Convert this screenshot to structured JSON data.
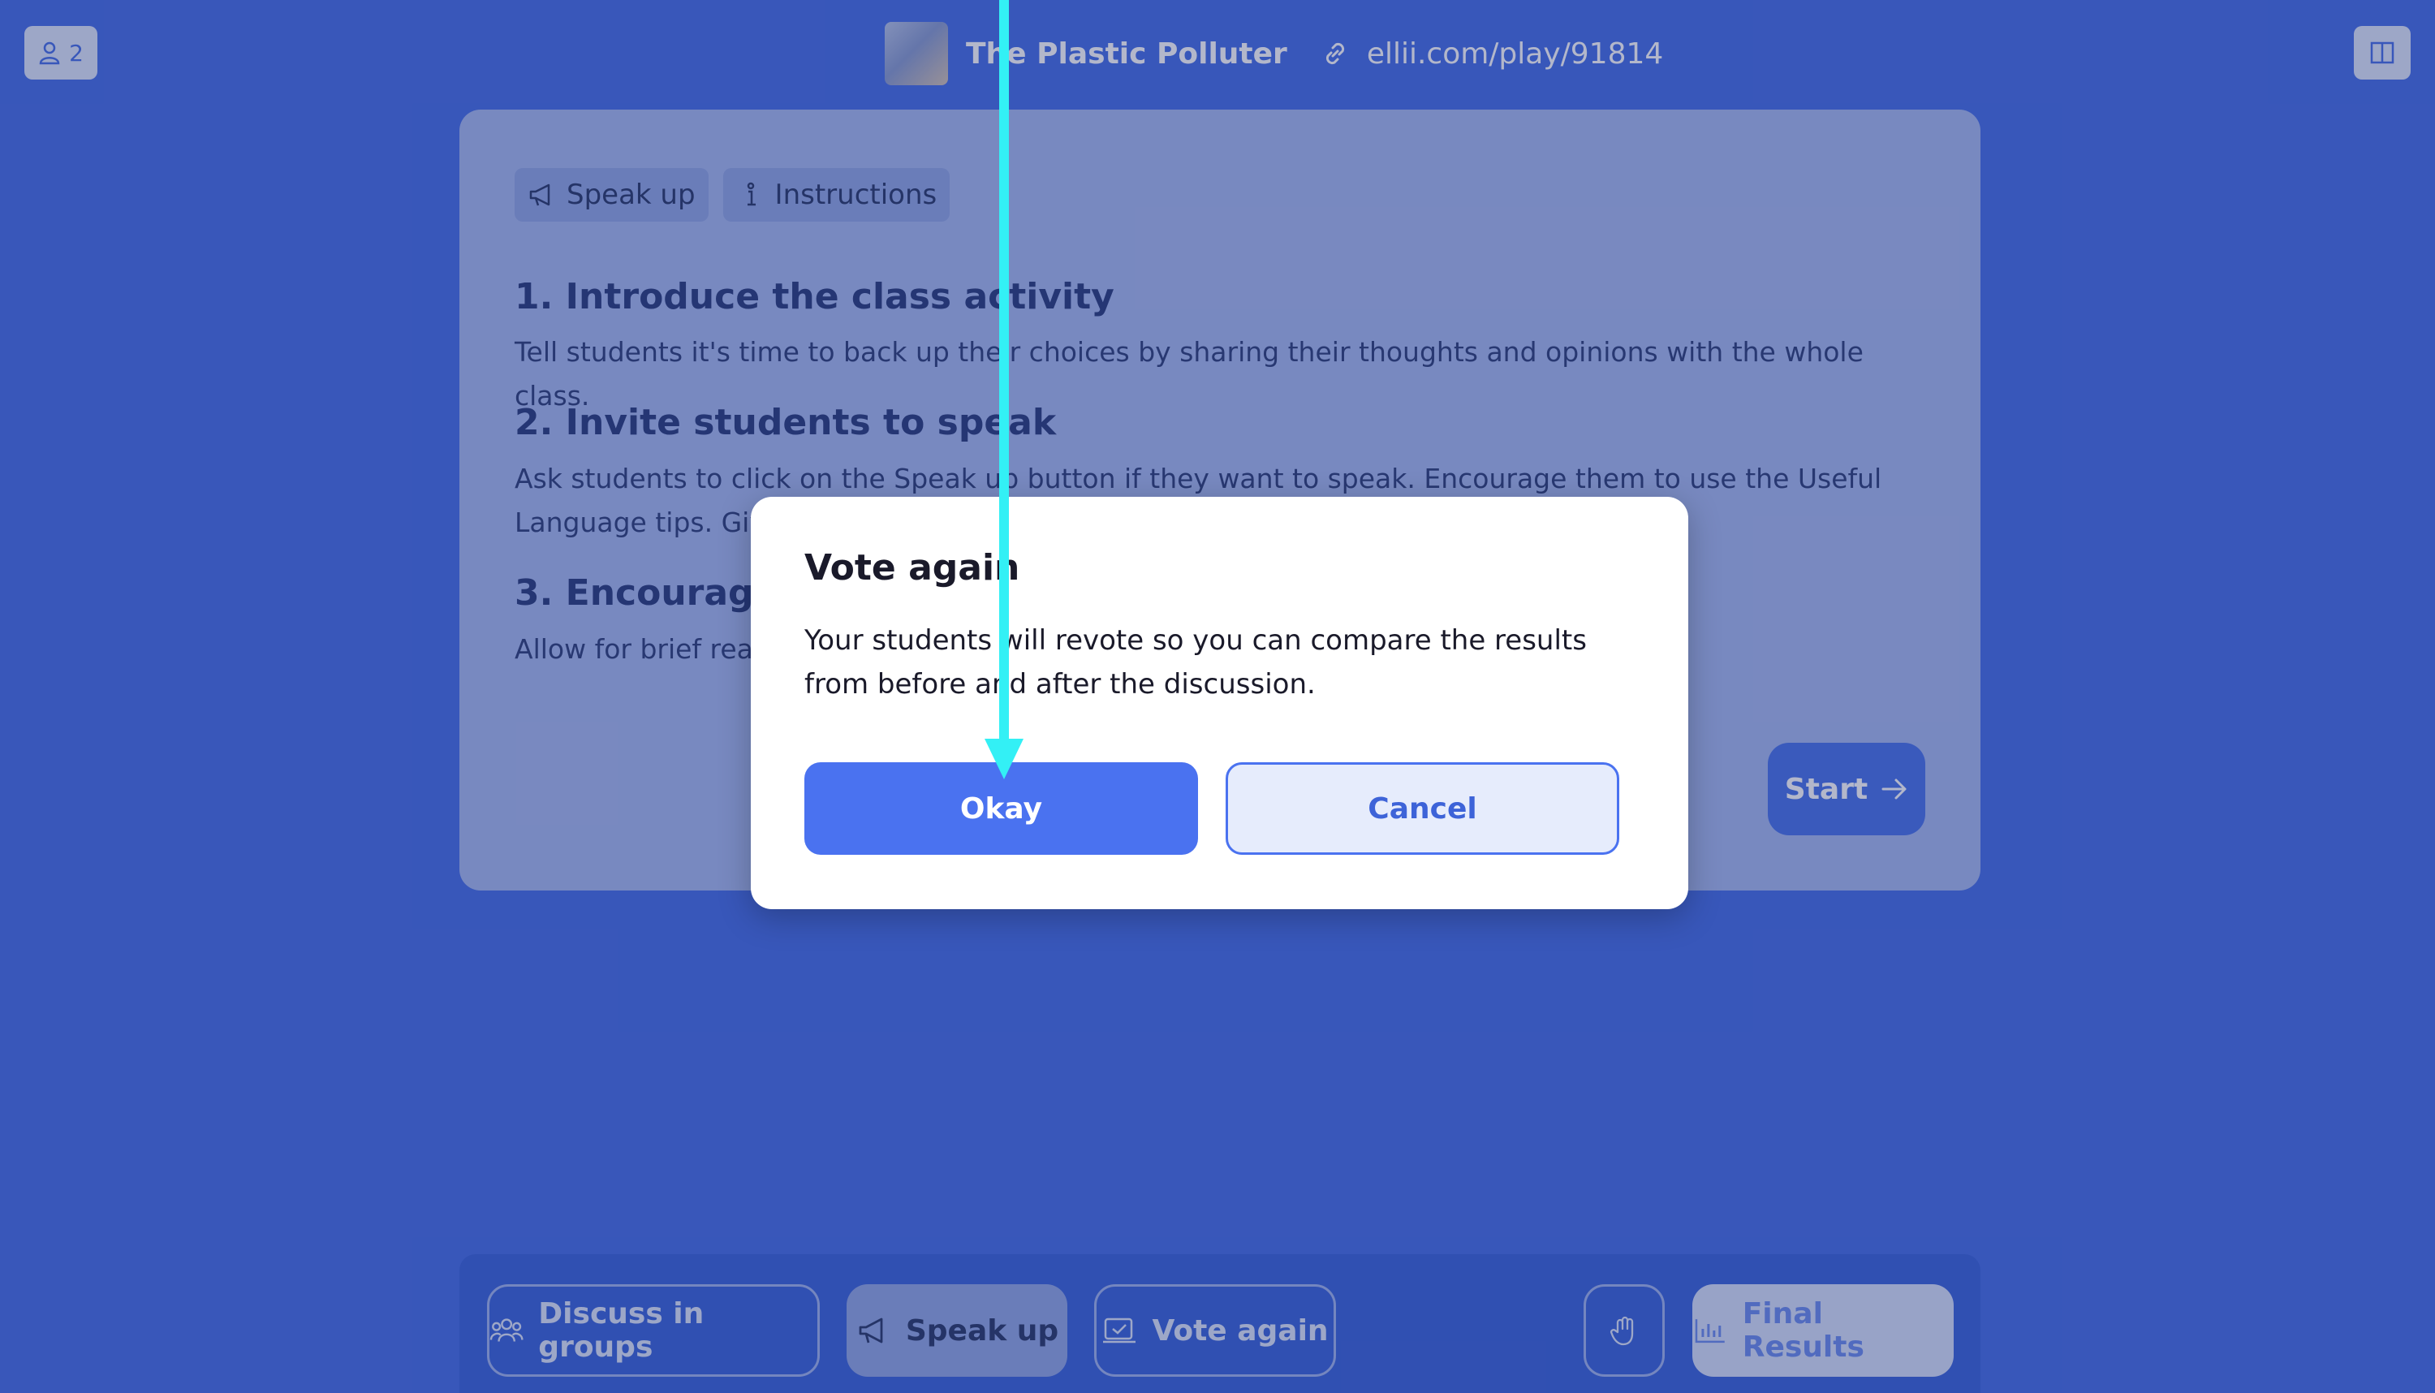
{
  "topbar": {
    "participants_count": "2",
    "lesson_title": "The Plastic Polluter",
    "lesson_link": "ellii.com/play/91814"
  },
  "instructions": {
    "tabs": [
      {
        "label": "Speak up",
        "icon": "megaphone-icon"
      },
      {
        "label": "Instructions",
        "icon": "info-icon"
      }
    ],
    "steps": [
      {
        "heading": "1. Introduce the class activity",
        "text": "Tell students it's time to back up their choices by sharing their thoughts and opinions with the whole class."
      },
      {
        "heading": "2. Invite students to speak",
        "text": "Ask students to click on the Speak up button if they want to speak. Encourage them to use the Useful Language tips. Give"
      },
      {
        "heading": "3. Encourage d",
        "text": "Allow for brief reactions from the class before inviting the next student to back up"
      }
    ],
    "start_label": "Start"
  },
  "bottom_bar": {
    "discuss_label": "Discuss in groups",
    "speak_label": "Speak up",
    "vote_label": "Vote again",
    "final_label": "Final Results"
  },
  "modal": {
    "title": "Vote again",
    "body": "Your students will revote so you can compare the results from before and after the discussion.",
    "okay_label": "Okay",
    "cancel_label": "Cancel"
  },
  "colors": {
    "brand_blue": "#4a72f0",
    "annotation_cyan": "#33f0f5"
  }
}
